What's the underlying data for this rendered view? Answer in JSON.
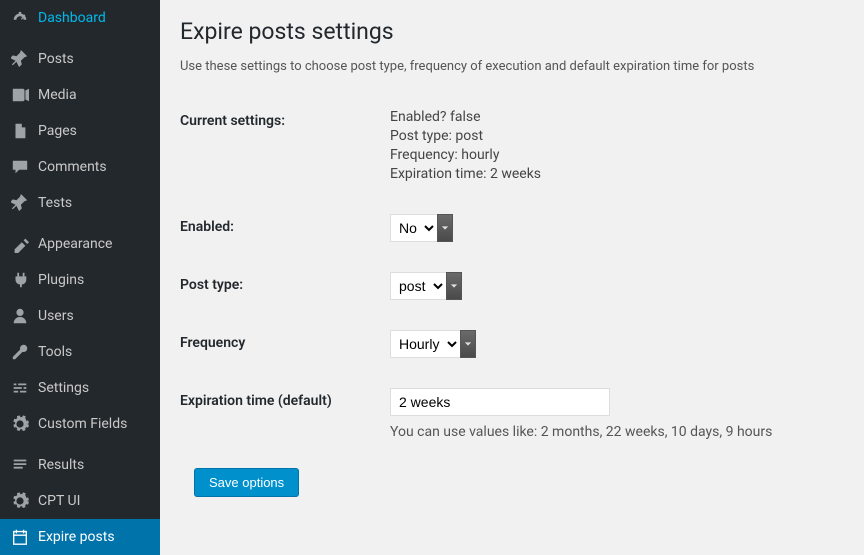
{
  "sidebar": {
    "items": [
      {
        "label": "Dashboard",
        "icon": "dashboard"
      },
      {
        "label": "Posts",
        "icon": "pin"
      },
      {
        "label": "Media",
        "icon": "media"
      },
      {
        "label": "Pages",
        "icon": "page"
      },
      {
        "label": "Comments",
        "icon": "comment"
      },
      {
        "label": "Tests",
        "icon": "pin"
      },
      {
        "label": "Appearance",
        "icon": "appearance"
      },
      {
        "label": "Plugins",
        "icon": "plugin"
      },
      {
        "label": "Users",
        "icon": "user"
      },
      {
        "label": "Tools",
        "icon": "tool"
      },
      {
        "label": "Settings",
        "icon": "settings"
      },
      {
        "label": "Custom Fields",
        "icon": "gear"
      },
      {
        "label": "Results",
        "icon": "results"
      },
      {
        "label": "CPT UI",
        "icon": "gear"
      },
      {
        "label": "Expire posts",
        "icon": "calendar"
      }
    ]
  },
  "page": {
    "title": "Expire posts settings",
    "description": "Use these settings to choose post type, frequency of execution and default expiration time for posts"
  },
  "current": {
    "heading": "Current settings:",
    "enabled_label": "Enabled?",
    "enabled_value": "false",
    "posttype_label": "Post type:",
    "posttype_value": "post",
    "frequency_label": "Frequency:",
    "frequency_value": "hourly",
    "expiration_label": "Expiration time:",
    "expiration_value": "2 weeks"
  },
  "form": {
    "enabled_label": "Enabled:",
    "enabled_value": "No",
    "posttype_label": "Post type:",
    "posttype_value": "post",
    "frequency_label": "Frequency",
    "frequency_value": "Hourly",
    "expiration_label": "Expiration time (default)",
    "expiration_value": "2 weeks",
    "expiration_hint": "You can use values like: 2 months, 22 weeks, 10 days, 9 hours",
    "save_label": "Save options"
  }
}
